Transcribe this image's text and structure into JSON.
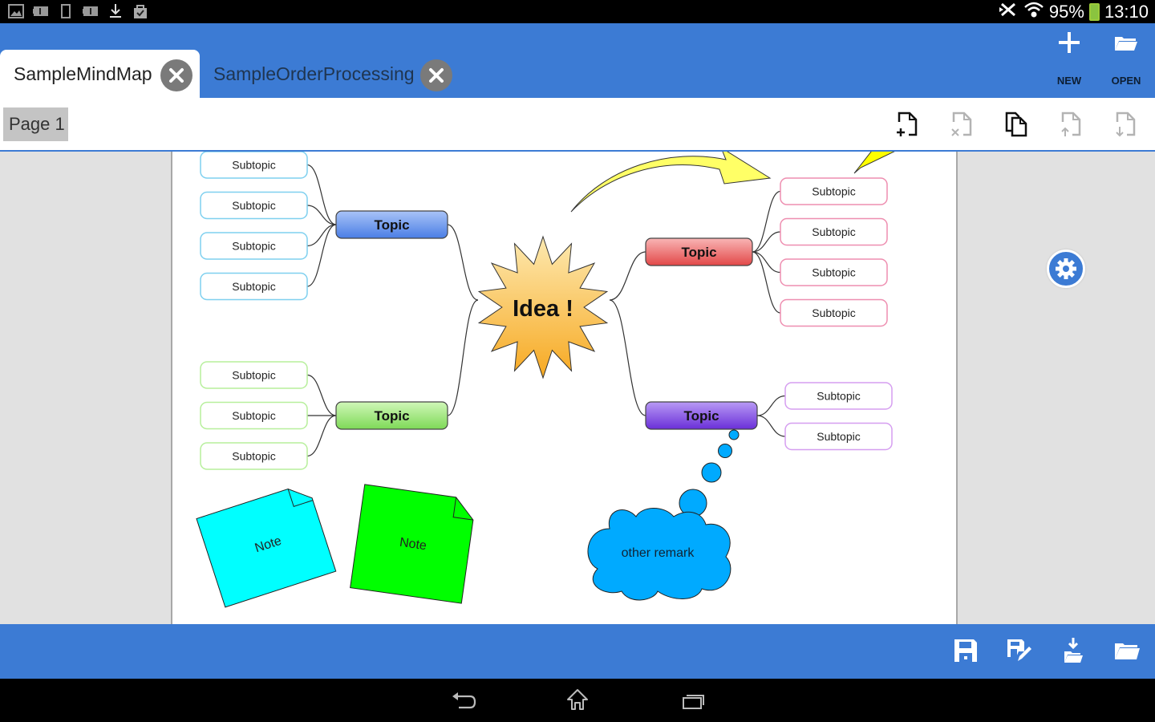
{
  "status_bar": {
    "left_icons": [
      "gallery-icon",
      "battery-info-icon",
      "phone-icon",
      "battery-info-icon",
      "download-icon",
      "shop-bag-icon"
    ],
    "right_icons": [
      "bluetooth-off-icon",
      "wifi-icon"
    ],
    "battery_percent": "95%",
    "time": "13:10",
    "battery_color": "#8ac43f"
  },
  "app_bar": {
    "tabs": [
      {
        "label": "SampleMindMap",
        "active": true
      },
      {
        "label": "SampleOrderProcessing",
        "active": false
      }
    ],
    "actions": [
      {
        "label": "NEW",
        "icon": "plus-icon"
      },
      {
        "label": "OPEN",
        "icon": "folder-open-icon"
      }
    ],
    "color": "#3c7bd4"
  },
  "page_bar": {
    "pages": [
      {
        "label": "Page 1",
        "active": true
      }
    ],
    "tools": [
      {
        "name": "add-page",
        "icon": "add-page-icon",
        "enabled": true
      },
      {
        "name": "delete-page",
        "icon": "delete-page-icon",
        "enabled": false
      },
      {
        "name": "duplicate-page",
        "icon": "duplicate-page-icon",
        "enabled": true
      },
      {
        "name": "move-page-up",
        "icon": "move-page-up-icon",
        "enabled": false
      },
      {
        "name": "move-page-down",
        "icon": "move-page-down-icon",
        "enabled": false
      }
    ]
  },
  "mindmap": {
    "central": {
      "label": "Idea !",
      "colors": [
        "#fde9b0",
        "#f7a922"
      ]
    },
    "topics": [
      {
        "id": "blue",
        "label": "Topic",
        "colors": [
          "#a9c3f7",
          "#4a7ee5"
        ],
        "sub_border": "#7fd0ef",
        "subtopics": [
          "Subtopic",
          "Subtopic",
          "Subtopic",
          "Subtopic"
        ]
      },
      {
        "id": "green",
        "label": "Topic",
        "colors": [
          "#d0f7b8",
          "#7ed957"
        ],
        "sub_border": "#b7ef9c",
        "subtopics": [
          "Subtopic",
          "Subtopic",
          "Subtopic"
        ]
      },
      {
        "id": "red",
        "label": "Topic",
        "colors": [
          "#f9b5b5",
          "#e24848"
        ],
        "sub_border": "#ee8eb0",
        "subtopics": [
          "Subtopic",
          "Subtopic",
          "Subtopic",
          "Subtopic"
        ]
      },
      {
        "id": "purple",
        "label": "Topic",
        "colors": [
          "#b89af5",
          "#6a2fd8"
        ],
        "sub_border": "#d59ef0",
        "subtopics": [
          "Subtopic",
          "Subtopic"
        ]
      }
    ],
    "notes": [
      {
        "label": "Note",
        "color": "#00ffff"
      },
      {
        "label": "Note",
        "color": "#00ff00"
      }
    ],
    "callout": {
      "label": "other remark",
      "color": "#00aaff"
    },
    "arrow_color": "#ffff66"
  },
  "settings_button": {
    "icon": "gear-icon"
  },
  "bottom_bar": {
    "tools": [
      {
        "name": "save",
        "icon": "save-icon"
      },
      {
        "name": "save-as",
        "icon": "save-as-icon"
      },
      {
        "name": "import",
        "icon": "import-icon"
      },
      {
        "name": "open",
        "icon": "folder-open-icon"
      }
    ]
  },
  "nav_bar": {
    "buttons": [
      {
        "name": "back",
        "icon": "back-icon"
      },
      {
        "name": "home",
        "icon": "home-icon"
      },
      {
        "name": "recents",
        "icon": "recents-icon"
      }
    ]
  }
}
